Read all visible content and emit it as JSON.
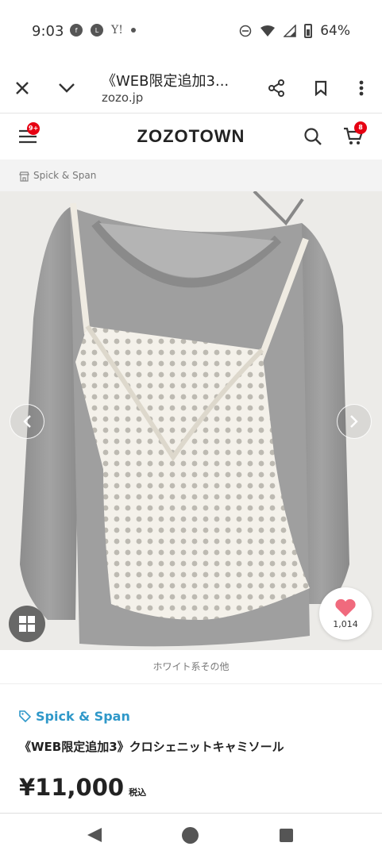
{
  "status_bar": {
    "time": "9:03",
    "battery": "64%",
    "notification_icons": [
      "facebook-icon",
      "line-icon",
      "yahoo-icon"
    ]
  },
  "browser": {
    "tab_title": "《WEB限定追加3...",
    "url": "zozo.jp"
  },
  "header": {
    "logo": "ZOZOTOWN",
    "menu_badge": "9+",
    "cart_badge": "8"
  },
  "shop": {
    "label": "Spick & Span"
  },
  "product": {
    "favorite_count": "1,014",
    "color_caption": "ホワイト系その他",
    "brand": "Spick & Span",
    "name": "《WEB限定追加3》クロシェニットキャミソール",
    "price": "¥11,000",
    "tax_label": "税込"
  },
  "colors": {
    "accent_blue": "#2f98c9",
    "badge_red": "#e60012",
    "heart_pink": "#f06a7d"
  }
}
